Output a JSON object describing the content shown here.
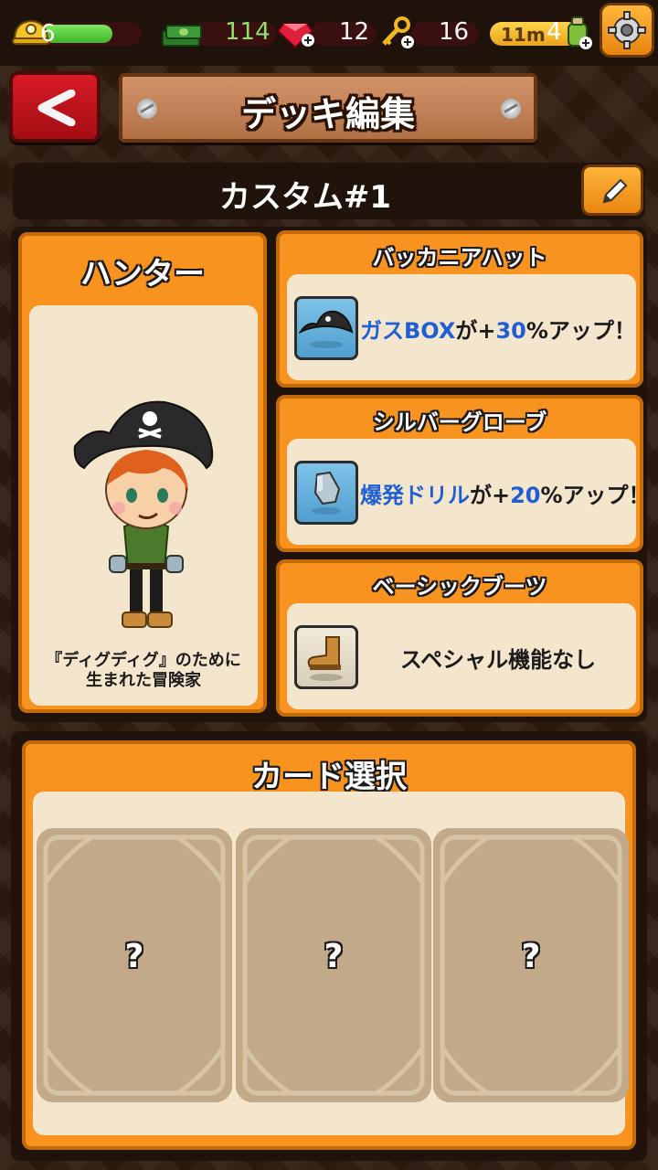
{
  "status": {
    "energy": "6",
    "energy_fill": 0.72,
    "cash": "114",
    "gems": "12",
    "keys": "16",
    "depth": "11m",
    "potions": "4"
  },
  "header": {
    "title": "デッキ編集"
  },
  "deck": {
    "name": "カスタム#1"
  },
  "character": {
    "name": "ハンター",
    "description_line1": "『ディグディグ』のために",
    "description_line2": "生まれた冒険家"
  },
  "equipment": [
    {
      "title": "バッカニアハット",
      "effect_highlight": "ガスBOX",
      "effect_mid": "が+",
      "effect_value": "30",
      "effect_tail": "%アップ！",
      "icon": "pirate-hat-icon"
    },
    {
      "title": "シルバーグローブ",
      "effect_highlight": "爆発ドリル",
      "effect_mid": "が+",
      "effect_value": "20",
      "effect_tail": "%アップ！",
      "icon": "silver-glove-icon"
    },
    {
      "title": "ベーシックブーツ",
      "effect_none": "スペシャル機能なし",
      "icon": "boot-icon"
    }
  ],
  "cards": {
    "title": "カード選択",
    "slots": [
      "?",
      "?",
      "?"
    ]
  },
  "colors": {
    "panel_orange": "#f7931e",
    "cream": "#f4e6cc",
    "highlight_blue": "#1f5fd6",
    "back_red": "#d81a24"
  }
}
